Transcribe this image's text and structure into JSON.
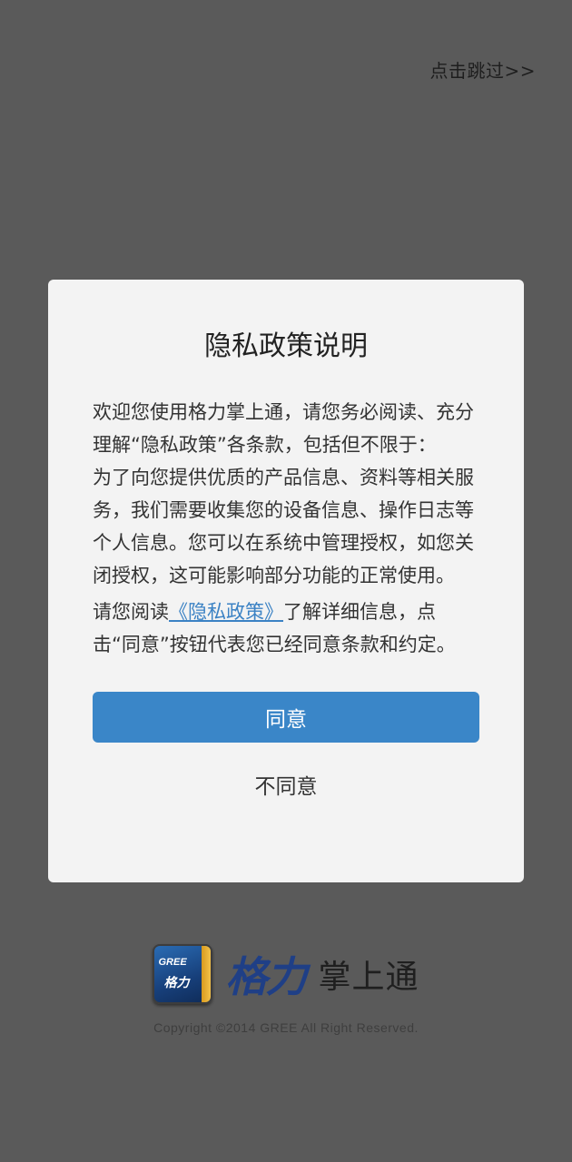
{
  "skip": {
    "label": "点击跳过>>"
  },
  "dialog": {
    "title": "隐私政策说明",
    "paragraph1": "欢迎您使用格力掌上通，请您务必阅读、充分理解“隐私政策”各条款，包括但不限于：",
    "paragraph2": "为了向您提供优质的产品信息、资料等相关服务，我们需要收集您的设备信息、操作日志等个人信息。您可以在系统中管理授权，如您关闭授权，这可能影响部分功能的正常使用。",
    "paragraph3_before": "请您阅读",
    "policy_link": "《隐私政策》",
    "paragraph3_after": "了解详细信息，点击“同意”按钮代表您已经同意条款和约定。",
    "agree_label": "同意",
    "disagree_label": "不同意"
  },
  "brand": {
    "icon_text": "GREE",
    "icon_glyph": "格力",
    "logo_text": "格力",
    "app_name": "掌上通"
  },
  "footer": {
    "copyright": "Copyright ©2014 GREE All Right Reserved."
  },
  "colors": {
    "overlay": "#5a5a5a",
    "dialog_bg": "#f3f3f3",
    "primary": "#3a86c8",
    "link": "#3b82c4",
    "brand_blue": "#1f3f86"
  }
}
